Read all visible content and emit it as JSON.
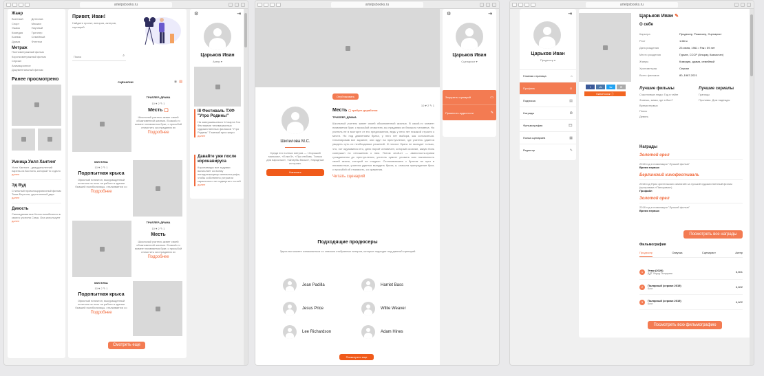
{
  "domains": {
    "p1": "artelpsbooks.ru",
    "p2": "artelpsbooks.ru",
    "p3": "artelpsbooks.ru"
  },
  "genre": {
    "title": "Жанр",
    "col1": [
      "Военный",
      "Спорт",
      "Ужасы",
      "Комедия",
      "Боевик",
      "Драма"
    ],
    "col2": [
      "Детектив",
      "Мюзикл",
      "Научный",
      "Триллер",
      "Семейный",
      "Фэнтези"
    ]
  },
  "metrazh": {
    "title": "Метраж",
    "items": [
      "Полнометражный фильм",
      "Короткометражный фильм",
      "Сериал",
      "Анимационное",
      "Документальный фильм"
    ]
  },
  "recent": {
    "title": "Ранее просмотрено",
    "items": [
      {
        "title": "Умница Уилл Хантинг",
        "text": "Уилл Хантинг - двадцатилетний парень из Бостона, который то и дело",
        "more": "далее"
      },
      {
        "title": "Эд Вуд",
        "text": "Стильный проволоцировочный фильм Тима Бертона, удостоенный двух",
        "more": "далее"
      },
      {
        "title": "Дикость",
        "text": "Самоадекватные Келли влюбляется в своего учителя Сэма. Она использует",
        "more": "далее"
      }
    ]
  },
  "hero": {
    "greeting": "Привет, Иван!",
    "sub": "Найдите проект, авторов, актеров, сценарий",
    "search": "Поиск"
  },
  "feed": {
    "tab": "СЦЕНАРИИ",
    "cards": [
      {
        "genre": "ТРИЛЛЕР, ДРАМА",
        "stats": "10 ♥ 2 ✎ 1",
        "title": "Месть",
        "text": "Школьный учитель живет своей обыкновенной жизнью. В какой-то момент появляется брат, с просьбой отомстить за страдания их",
        "more": "Подробнее"
      },
      {
        "genre": "МИСТИКА",
        "stats": "10 ♥ 2 ✎ 1",
        "title": "Подопытная крыса",
        "text": "Офисный планктон, выкуражденный остаться на ночь на работе в здании бывшей психбольницы, сталкивается со",
        "more": "Подробнее"
      },
      {
        "genre": "ТРИЛЛЕР, ДРАМА",
        "stats": "10 ♥ 2 ✎ 1",
        "title": "Месть",
        "text": "Школьный учитель живет своей обыкновенной жизнью. В какой-то момент появляется брат, с просьбой отомстить за страдания их",
        "more": "Подробнее"
      },
      {
        "genre": "МИСТИКА",
        "stats": "10 ♥ 2 ✎ 1",
        "title": "Подопытная крыса",
        "text": "Офисный планктон, выкуражденный остаться на ночь на работе в здании бывшей психбольницы, сталкивается со",
        "more": "Подробнее"
      }
    ],
    "more_button": "Смотреть еще"
  },
  "profile1": {
    "name": "Царьков Иван",
    "role": "Актер ▾"
  },
  "news": [
    {
      "title": "III Фестиваль ТХФ \"Утро Родины\"",
      "text": "На завершившемся 14 марта 3-м Фестивале телевизионных художественных фильмов \"Утро Родины\" Главный приз жюри",
      "more": "далее"
    },
    {
      "title": "Давайте уже после коронавируса",
      "text": "Коронавирус все задумки вычисляет со всему ненадлежащему кинематографа, чтобы собственно устроили карантина и не подвергать гостей",
      "more": "далее"
    }
  ],
  "script": {
    "publish": "Опубликовать",
    "author": "Шипилова М.С.",
    "author_text": "Среди его полных метров — «Хороший мальчик», «Елки 5», «Про любовь. Только для взрослых», «Штирбы босых», Народные историки.",
    "write": "Написать",
    "title": "Месть",
    "status": "требует доработки",
    "stats": "10 ♥ 2 ✎ 1",
    "genre": "ТРИЛЛЕР, ДРАМА",
    "body": "Школьный учитель живет своей обыкновенной жизнью. В какой-то момент появляется брат, с просьбой отомстить за страдания их близкого человека. Но учитель не в восторге от его предложения, ведь у него нет никакой страсти к мести. Но под давлением брата, у него нет выбора, как согласиться. Спланировав все заранее, они идут на преступление, где учитель удается увидеть суть их необходимых решений. И плохое брата не выходит только, что, эст одухавился его, дело порой человечен, который осознал, какую боль совершил по отношению к ним. Потом злой-от — авиполости-прими грожданином до преступления, учитель сумеет уловить всю никчемность своей жизни, который не стадион. Остановившись с братом на пути в неизвестные, учителя удается вынудить брата, и, сначала принуждение брат, с просьбой об стоимость, со сражения.",
    "read": "Читать сценарий"
  },
  "producers": {
    "title": "Подходящие продюсеры",
    "sub": "Здесь вы можете ознакомиться со списком отобранных актеров, которые подходят под данный сценарий",
    "people": [
      "Jean Padilla",
      "Harriet Bass",
      "Jesus Price",
      "Willie Weaver",
      "Lee Richardson",
      "Adam Hines"
    ],
    "more": "Посмотреть еще"
  },
  "profile2": {
    "name": "Царьков Иван",
    "role": "Сценарист ▾",
    "actions": [
      "Загрузить сценарий",
      "Приватить аудиоглоги"
    ]
  },
  "profile3": {
    "name": "Царьков Иван",
    "role": "Продюсер ▾",
    "menu": [
      "Главная страница",
      "Профиль",
      "Подписка",
      "Награды",
      "Фильмография",
      "Полка сценариев",
      "Редактор"
    ]
  },
  "about": {
    "name": "Царьков Иван",
    "title": "О себе",
    "rows": [
      [
        "Карьера",
        "Продюсер, Режиссер, Сценарист"
      ],
      [
        "Рост",
        "1.68 м"
      ],
      [
        "Дата рождения",
        "23 июня, 1961 • Рак • 59 лет"
      ],
      [
        "Место рождения",
        "Гурьев, СССР (Атырау, Казахстан)"
      ],
      [
        "Жанры",
        "Комедия, драма, семейный"
      ],
      [
        "Хронометраж",
        "Сериал"
      ],
      [
        "Всего фильмов",
        "80, 1987-2021"
      ]
    ],
    "best_films": {
      "title": "Лучшие фильмы",
      "items": [
        "Счастливые люди: Год в тайге",
        "Знаешь, мама, где я был?",
        "Время первых",
        "Поиск",
        "Девять"
      ]
    },
    "best_series": {
      "title": "Лучшие сериалы",
      "items": [
        "Границы",
        "Пролимы. Дом надежды"
      ]
    },
    "social": [
      "f",
      "vk",
      "tw",
      "✉"
    ],
    "kinopoisk": "КиноПоиск"
  },
  "awards": {
    "title": "Награды",
    "items": [
      {
        "name": "Золотой орел",
        "text": "2018 год в номинации \"Лучший фильм\"",
        "film": "Время первых"
      },
      {
        "name": "Берлинский кинофестиваль",
        "text": "2018 год Приз зрительских симпатий за лучший художественный фильм (программа «Панорама»)",
        "film": "Профайл"
      },
      {
        "name": "Золотой орел",
        "text": "2018 год в номинации \"Лучший фильм\"",
        "film": "Время первых"
      }
    ],
    "all": "Посмотреть все награды"
  },
  "filmography": {
    "title": "Фильмография",
    "tabs": [
      "Продюсер",
      "Озвучка",
      "Сценарист",
      "Актер"
    ],
    "items": [
      {
        "n": "1",
        "title": "Этаж (2020)",
        "sub": "ДДТ Ледод Полукреак",
        "rating": "6,601"
      },
      {
        "n": "2",
        "title": "Полярный (сериал 2019)",
        "sub": "Блог",
        "rating": "6,602"
      },
      {
        "n": "3",
        "title": "Полярный (сериал 2019)",
        "sub": "Блог",
        "rating": "6,602"
      }
    ],
    "all": "Посмотреть всю фильмографию"
  }
}
